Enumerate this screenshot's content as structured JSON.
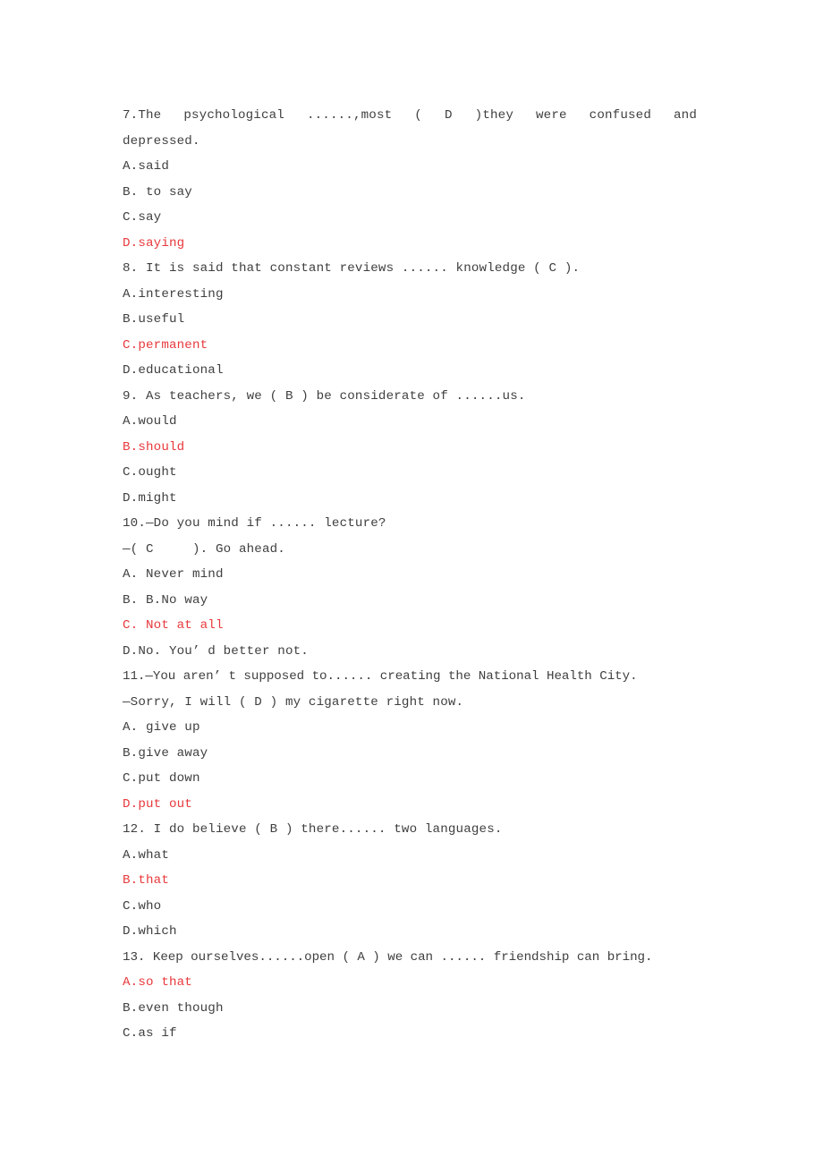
{
  "document": {
    "page_background": "#ffffff",
    "text_color": "#3f3f3f",
    "answer_color": "#e8393c",
    "questions": [
      {
        "number": "7",
        "stem_lines": [
          "7.The  psychological  ......,most  ( D )they  were  confused  and",
          "depressed."
        ],
        "options": [
          {
            "label": "A.said",
            "correct": false
          },
          {
            "label": "B. to say",
            "correct": false
          },
          {
            "label": "C.say",
            "correct": false
          },
          {
            "label": "D.saying",
            "correct": true
          }
        ]
      },
      {
        "number": "8",
        "stem_lines": [
          "8. It is said that constant reviews ...... knowledge ( C )."
        ],
        "options": [
          {
            "label": "A.interesting",
            "correct": false
          },
          {
            "label": "B.useful",
            "correct": false
          },
          {
            "label": "C.permanent",
            "correct": true
          },
          {
            "label": "D.educational",
            "correct": false
          }
        ]
      },
      {
        "number": "9",
        "stem_lines": [
          "9. As teachers, we ( B ) be considerate of ......us."
        ],
        "options": [
          {
            "label": "A.would",
            "correct": false
          },
          {
            "label": "B.should",
            "correct": true
          },
          {
            "label": "C.ought",
            "correct": false
          },
          {
            "label": "D.might",
            "correct": false
          }
        ]
      },
      {
        "number": "10",
        "stem_lines": [
          "10.—Do you mind if ...... lecture?",
          "—( C     ). Go ahead."
        ],
        "options": [
          {
            "label": "A. Never mind",
            "correct": false
          },
          {
            "label": "B. B.No way",
            "correct": false
          },
          {
            "label": "C. Not at all",
            "correct": true
          },
          {
            "label": "D.No. You’ d better not.",
            "correct": false
          }
        ]
      },
      {
        "number": "11",
        "stem_lines": [
          "11.—You aren’ t supposed to...... creating the National Health City.",
          "—Sorry, I will ( D ) my cigarette right now."
        ],
        "options": [
          {
            "label": "A. give up",
            "correct": false
          },
          {
            "label": "B.give away",
            "correct": false
          },
          {
            "label": "C.put down",
            "correct": false
          },
          {
            "label": "D.put out",
            "correct": true
          }
        ]
      },
      {
        "number": "12",
        "stem_lines": [
          "12. I do believe ( B ) there...... two languages."
        ],
        "options": [
          {
            "label": "A.what",
            "correct": false
          },
          {
            "label": "B.that",
            "correct": true
          },
          {
            "label": "C.who",
            "correct": false
          },
          {
            "label": "D.which",
            "correct": false
          }
        ]
      },
      {
        "number": "13",
        "stem_lines": [
          "13. Keep ourselves......open ( A ) we can ...... friendship can bring."
        ],
        "options": [
          {
            "label": "A.so that",
            "correct": true
          },
          {
            "label": "B.even though",
            "correct": false
          },
          {
            "label": "C.as if",
            "correct": false
          }
        ]
      }
    ]
  },
  "lines": [
    {
      "text": "7.The  psychological  ......,most  ( D )they  were  confused  and",
      "kind": "stem-justified",
      "answer": false
    },
    {
      "text": "depressed.",
      "kind": "stem",
      "answer": false
    },
    {
      "text": "A.said",
      "kind": "option",
      "answer": false
    },
    {
      "text": "B. to say",
      "kind": "option",
      "answer": false
    },
    {
      "text": "C.say",
      "kind": "option",
      "answer": false
    },
    {
      "text": "D.saying",
      "kind": "option",
      "answer": true
    },
    {
      "text": "8. It is said that constant reviews ...... knowledge ( C ).",
      "kind": "stem",
      "answer": false
    },
    {
      "text": "A.interesting",
      "kind": "option",
      "answer": false
    },
    {
      "text": "B.useful",
      "kind": "option",
      "answer": false
    },
    {
      "text": "C.permanent",
      "kind": "option",
      "answer": true
    },
    {
      "text": "D.educational",
      "kind": "option",
      "answer": false
    },
    {
      "text": "9. As teachers, we ( B ) be considerate of ......us.",
      "kind": "stem",
      "answer": false
    },
    {
      "text": "A.would",
      "kind": "option",
      "answer": false
    },
    {
      "text": "B.should",
      "kind": "option",
      "answer": true
    },
    {
      "text": "C.ought",
      "kind": "option",
      "answer": false
    },
    {
      "text": "D.might",
      "kind": "option",
      "answer": false
    },
    {
      "text": "10.—Do you mind if ...... lecture?",
      "kind": "stem",
      "answer": false
    },
    {
      "text": "—( C     ). Go ahead.",
      "kind": "stem",
      "answer": false
    },
    {
      "text": "A. Never mind",
      "kind": "option",
      "answer": false
    },
    {
      "text": "B. B.No way",
      "kind": "option",
      "answer": false
    },
    {
      "text": "C. Not at all",
      "kind": "option",
      "answer": true
    },
    {
      "text": "D.No. You’ d better not.",
      "kind": "option",
      "answer": false
    },
    {
      "text": "11.—You aren’ t supposed to...... creating the National Health City.",
      "kind": "stem-tight",
      "answer": false
    },
    {
      "text": "—Sorry, I will ( D ) my cigarette right now.",
      "kind": "stem",
      "answer": false
    },
    {
      "text": "A. give up",
      "kind": "option",
      "answer": false
    },
    {
      "text": "B.give away",
      "kind": "option",
      "answer": false
    },
    {
      "text": "C.put down",
      "kind": "option",
      "answer": false
    },
    {
      "text": "D.put out",
      "kind": "option",
      "answer": true
    },
    {
      "text": "12. I do believe ( B ) there...... two languages.",
      "kind": "stem",
      "answer": false
    },
    {
      "text": "A.what",
      "kind": "option",
      "answer": false
    },
    {
      "text": "B.that",
      "kind": "option",
      "answer": true
    },
    {
      "text": "C.who",
      "kind": "option",
      "answer": false
    },
    {
      "text": "D.which",
      "kind": "option",
      "answer": false
    },
    {
      "text": "13. Keep ourselves......open ( A ) we can ...... friendship can bring.",
      "kind": "stem-tight",
      "answer": false
    },
    {
      "text": "A.so that",
      "kind": "option",
      "answer": true
    },
    {
      "text": "B.even though",
      "kind": "option",
      "answer": false
    },
    {
      "text": "C.as if",
      "kind": "option",
      "answer": false
    }
  ]
}
